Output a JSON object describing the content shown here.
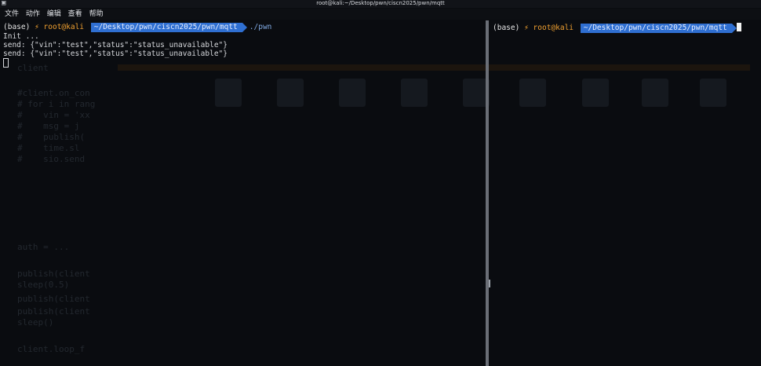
{
  "window": {
    "title": "root@kali:~/Desktop/pwn/ciscn2025/pwn/mqtt",
    "icon": "terminal-icon"
  },
  "menu": [
    "文件",
    "动作",
    "编辑",
    "查看",
    "帮助"
  ],
  "left_pane": {
    "prompt": {
      "env": "(base)",
      "user": "root@kali",
      "path": "~/Desktop/pwn/ciscn2025/pwn/mqtt",
      "command": "./pwn"
    },
    "output": [
      "Init ...",
      "send: {\"vin\":\"test\",\"status\":\"status_unavailable\"}",
      "send: {\"vin\":\"test\",\"status\":\"status_unavailable\"}"
    ]
  },
  "right_pane": {
    "prompt": {
      "env": "(base)",
      "user": "root@kali",
      "path": "~/Desktop/pwn/ciscn2025/pwn/mqtt"
    }
  },
  "colors": {
    "background": "#0a0c10",
    "path_segment": "#2f6fd1",
    "user": "#f0a030",
    "command": "#7fa8e0"
  }
}
